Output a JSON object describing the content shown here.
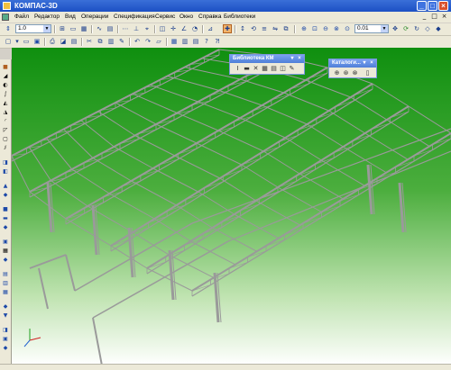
{
  "window": {
    "title": "КОМПАС-3D"
  },
  "menu": {
    "items": [
      "Файл",
      "Редактор",
      "Вид",
      "Операции",
      "Спецификация",
      "Сервис",
      "Окно",
      "Справка",
      "Библиотеки"
    ]
  },
  "toolbar1": {
    "scale_value": "1.0",
    "zoom_value": "0.01"
  },
  "panels": {
    "library": {
      "title": "Библиотека КМ",
      "close": "×",
      "pin": "▾"
    },
    "catalog": {
      "title": "Каталоги...",
      "close": "×",
      "pin": "▾"
    }
  },
  "axes": {
    "x": "x",
    "y": "y",
    "z": "z"
  },
  "icons": {
    "minimize": "_",
    "maximize": "□",
    "close": "×"
  },
  "colors": {
    "viewport_top": "#0f8f0f",
    "viewport_bottom": "#ffffff",
    "structure": "#9a9a9a",
    "titlebar": "#1c50c4"
  }
}
